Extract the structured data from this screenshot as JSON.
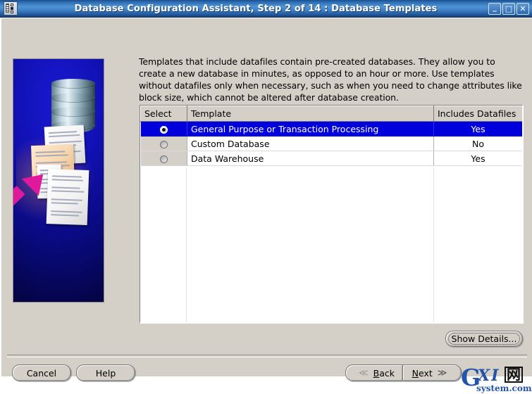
{
  "window": {
    "title": "Database Configuration Assistant, Step 2 of 14 : Database Templates",
    "icon": "app-icon",
    "controls": {
      "minimize": "_",
      "maximize": "□",
      "close": "✕"
    }
  },
  "main": {
    "instructions": "Templates that include datafiles contain pre-created databases. They allow you to create a new database in minutes, as opposed to an hour or more. Use templates without datafiles only when necessary, such as when you need to change attributes like block size, which cannot be altered after database creation.",
    "table": {
      "headers": [
        "Select",
        "Template",
        "Includes Datafiles"
      ],
      "rows": [
        {
          "selected": true,
          "template": "General Purpose or Transaction Processing",
          "includes_datafiles": "Yes"
        },
        {
          "selected": false,
          "template": "Custom Database",
          "includes_datafiles": "No"
        },
        {
          "selected": false,
          "template": "Data Warehouse",
          "includes_datafiles": "Yes"
        }
      ]
    },
    "show_details_label": "Show Details..."
  },
  "footer": {
    "cancel_label": "Cancel",
    "help_label": "Help",
    "back_label": "Back",
    "back_mnemonic": "B",
    "back_chevron": "≪",
    "next_label": "Next",
    "next_mnemonic": "N",
    "next_chevron": "≫"
  },
  "watermark": {
    "letter": "G",
    "mid": "XI",
    "cn": "网",
    "domain": "system.com"
  },
  "colors": {
    "titlebar_blue": "#2f6fb5",
    "selection_blue": "#0000dd",
    "dialog_gray": "#d4d0c8",
    "art_blue": "#1111b5",
    "arrow_magenta": "#e0189b"
  }
}
